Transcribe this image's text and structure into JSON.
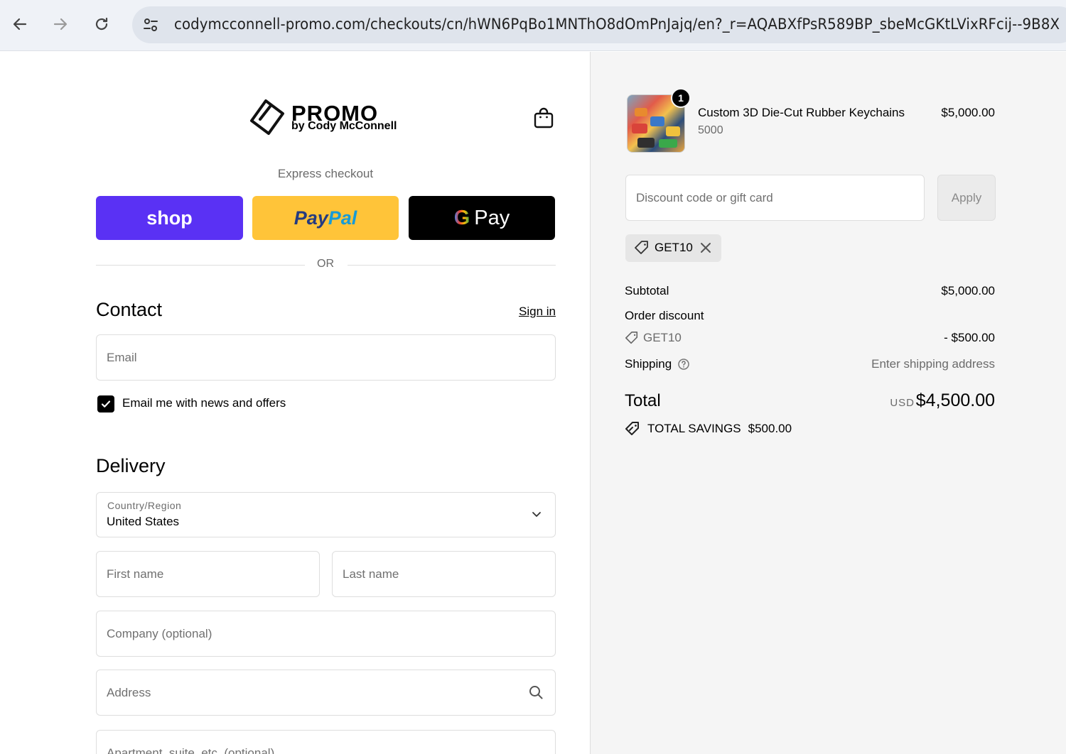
{
  "browser": {
    "url": "codymcconnell-promo.com/checkouts/cn/hWN6PqBo1MNThO8dOmPnJajq/en?_r=AQABXfPsR589BP_sbeMcGKtLVixRFcij--9B8X"
  },
  "brand": {
    "name": "PROMO",
    "tagline": "by Cody McConnell"
  },
  "express": {
    "label": "Express checkout",
    "shop_label": "shop",
    "paypal_part1": "Pay",
    "paypal_part2": "Pal",
    "gpay_g": "G",
    "gpay_label": "Pay",
    "or_label": "OR"
  },
  "contact": {
    "title": "Contact",
    "sign_in": "Sign in",
    "email_placeholder": "Email",
    "newsletter_label": "Email me with news and offers",
    "newsletter_checked": true
  },
  "delivery": {
    "title": "Delivery",
    "country_label": "Country/Region",
    "country_value": "United States",
    "first_name_placeholder": "First name",
    "last_name_placeholder": "Last name",
    "company_placeholder": "Company (optional)",
    "address_placeholder": "Address",
    "apartment_placeholder": "Apartment, suite, etc. (optional)"
  },
  "order": {
    "item": {
      "name": "Custom 3D Die-Cut Rubber Keychains",
      "variant": "5000",
      "price": "$5,000.00",
      "quantity": "1"
    },
    "discount_placeholder": "Discount code or gift card",
    "apply_label": "Apply",
    "applied_code": "GET10",
    "subtotal_label": "Subtotal",
    "subtotal_value": "$5,000.00",
    "order_discount_label": "Order discount",
    "discount_code": "GET10",
    "discount_value": "- $500.00",
    "shipping_label": "Shipping",
    "shipping_value": "Enter shipping address",
    "total_label": "Total",
    "total_currency": "USD",
    "total_value": "$4,500.00",
    "savings_label": "TOTAL SAVINGS",
    "savings_value": "$500.00"
  }
}
